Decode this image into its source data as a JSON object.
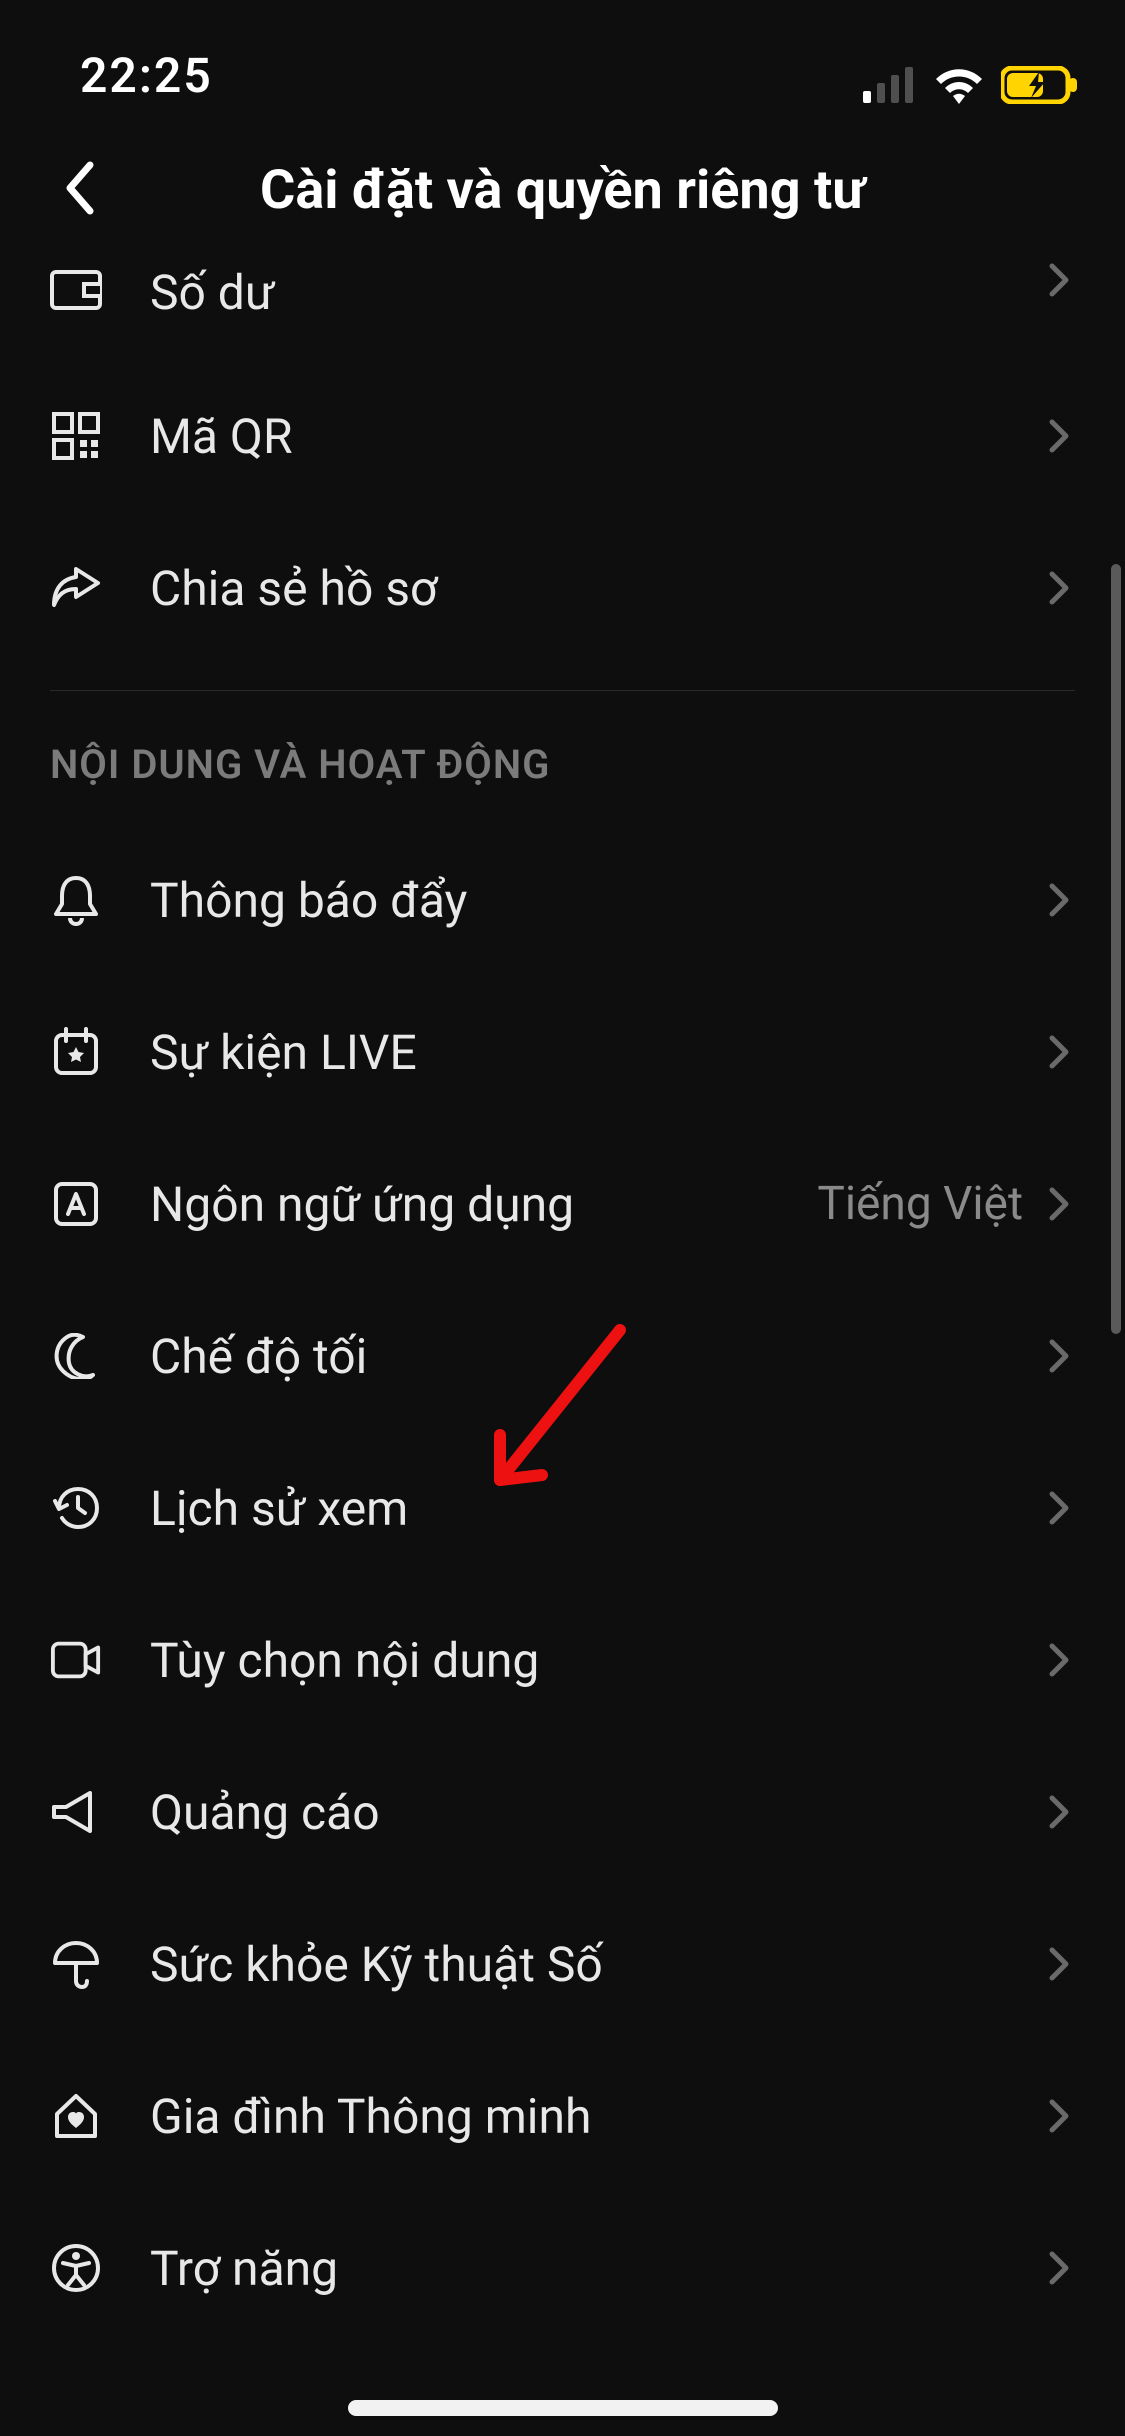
{
  "status": {
    "time": "22:25"
  },
  "header": {
    "title": "Cài đặt và quyền riêng tư"
  },
  "rows_top": [
    {
      "icon": "wallet-icon",
      "label": "Số dư"
    },
    {
      "icon": "qr-icon",
      "label": "Mã QR"
    },
    {
      "icon": "share-icon",
      "label": "Chia sẻ hồ sơ"
    }
  ],
  "section": {
    "header": "NỘI DUNG VÀ HOẠT ĐỘNG"
  },
  "rows_main": [
    {
      "icon": "bell-icon",
      "label": "Thông báo đẩy",
      "value": ""
    },
    {
      "icon": "calendar-icon",
      "label": "Sự kiện LIVE",
      "value": ""
    },
    {
      "icon": "language-icon",
      "label": "Ngôn ngữ ứng dụng",
      "value": "Tiếng Việt"
    },
    {
      "icon": "moon-icon",
      "label": "Chế độ tối",
      "value": ""
    },
    {
      "icon": "history-icon",
      "label": "Lịch sử xem",
      "value": ""
    },
    {
      "icon": "video-icon",
      "label": "Tùy chọn nội dung",
      "value": ""
    },
    {
      "icon": "megaphone-icon",
      "label": "Quảng cáo",
      "value": ""
    },
    {
      "icon": "umbrella-icon",
      "label": "Sức khỏe Kỹ thuật Số",
      "value": ""
    },
    {
      "icon": "home-heart-icon",
      "label": "Gia đình Thông minh",
      "value": ""
    },
    {
      "icon": "accessibility-icon",
      "label": "Trợ năng",
      "value": ""
    }
  ]
}
